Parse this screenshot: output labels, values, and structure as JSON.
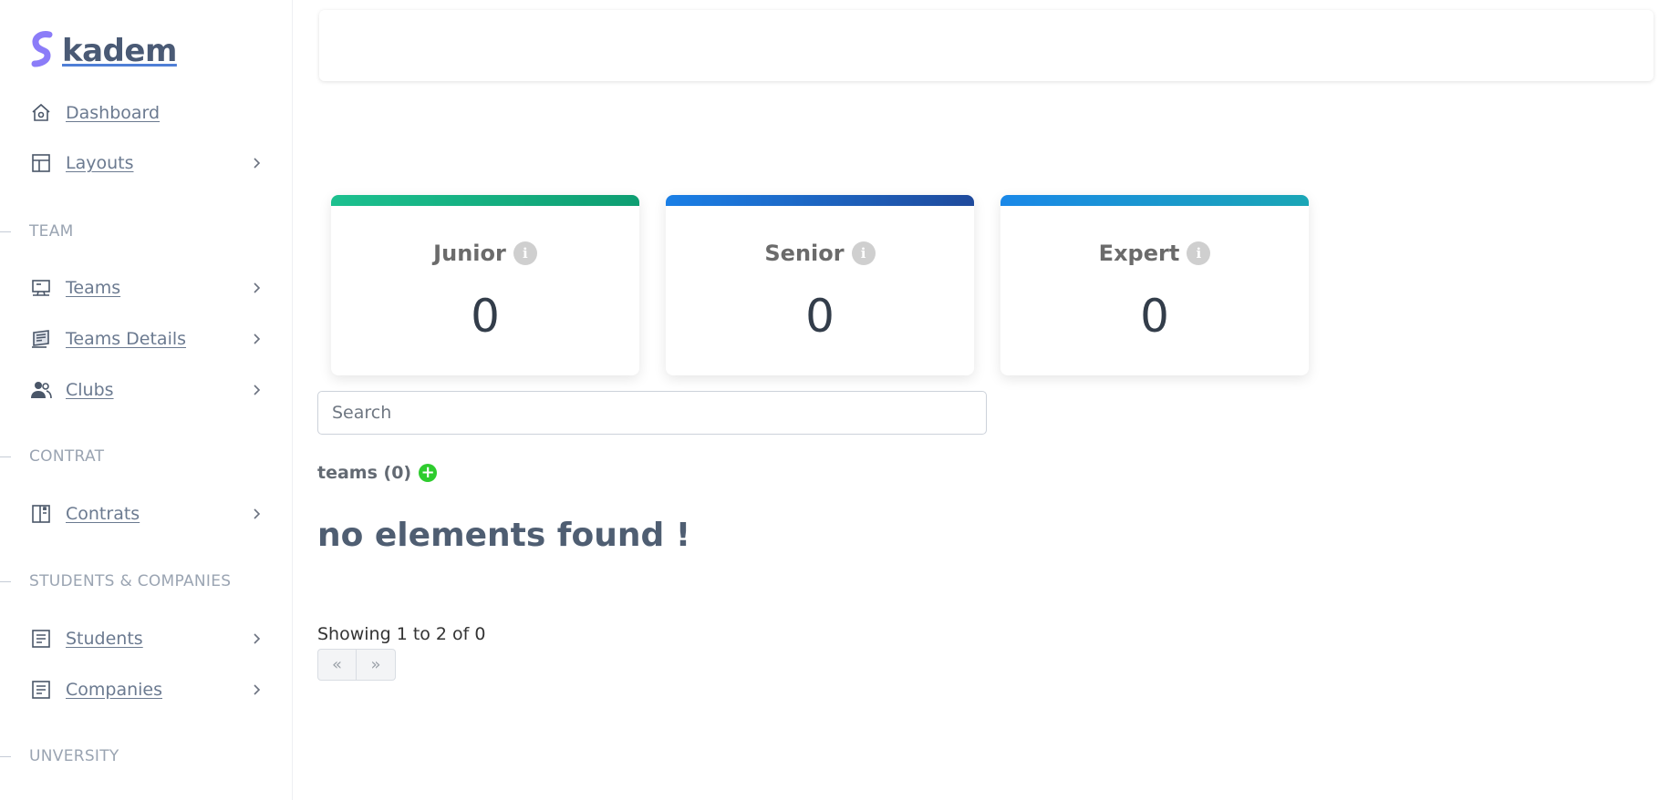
{
  "brand": {
    "name": "kadem",
    "logo_icon": "s-logo-icon",
    "logo_color": "#7b6cf6"
  },
  "sidebar": {
    "items": [
      {
        "label": "Dashboard",
        "icon": "home-icon"
      },
      {
        "label": "Layouts",
        "icon": "layout-icon"
      },
      {
        "label": "Teams",
        "icon": "presentation-icon"
      },
      {
        "label": "Teams Details",
        "icon": "cards-icon"
      },
      {
        "label": "Clubs",
        "icon": "users-icon"
      },
      {
        "label": "Contrats",
        "icon": "book-icon"
      },
      {
        "label": "Students",
        "icon": "document-icon"
      },
      {
        "label": "Companies",
        "icon": "document-icon"
      }
    ],
    "sections": {
      "team": "TEAM",
      "contrat": "CONTRAT",
      "students_companies": "STUDENTS & COMPANIES",
      "university": "UNVERSITY"
    }
  },
  "cards": [
    {
      "title": "Junior",
      "value": "0",
      "color_from": "#1cc08f",
      "color_to": "#0e9e72"
    },
    {
      "title": "Senior",
      "value": "0",
      "color_from": "#1a7fe6",
      "color_to": "#1f4a9c"
    },
    {
      "title": "Expert",
      "value": "0",
      "color_from": "#1a88e8",
      "color_to": "#1aa6b5"
    }
  ],
  "search": {
    "placeholder": "Search",
    "value": ""
  },
  "teams": {
    "label": "teams (0)",
    "add_icon": "plus-circle-icon",
    "add_color": "#2ecc2e"
  },
  "empty_message": "no elements found !",
  "pagination": {
    "showing": "Showing 1 to 2 of 0",
    "prev": "«",
    "next": "»"
  }
}
